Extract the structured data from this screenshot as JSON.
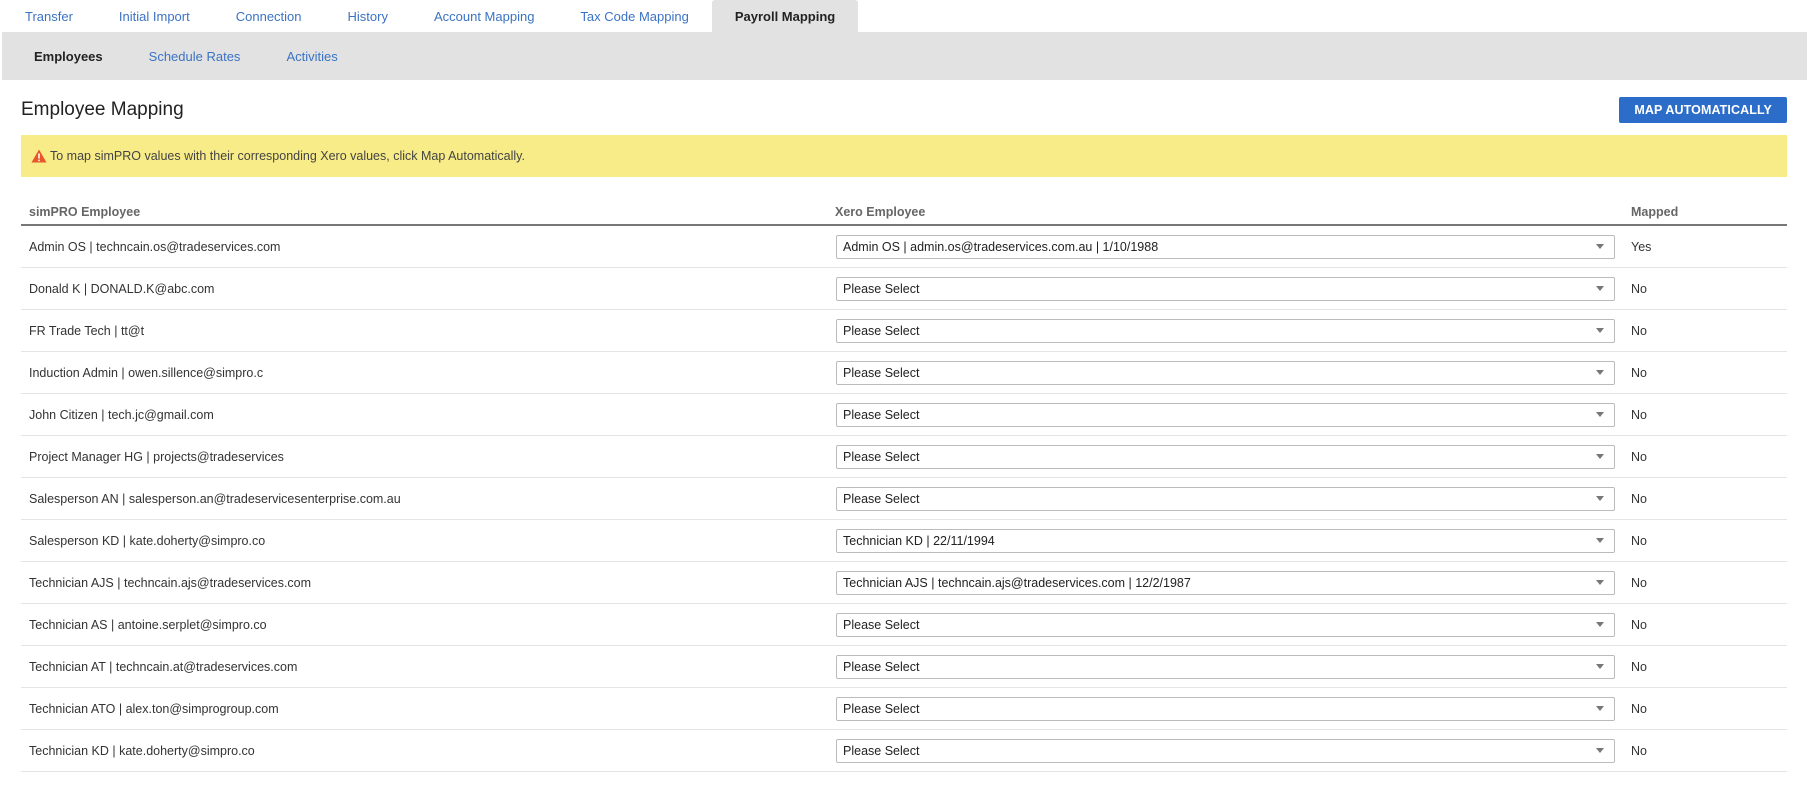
{
  "top_tabs": [
    {
      "label": "Transfer"
    },
    {
      "label": "Initial Import"
    },
    {
      "label": "Connection"
    },
    {
      "label": "History"
    },
    {
      "label": "Account Mapping"
    },
    {
      "label": "Tax Code Mapping"
    },
    {
      "label": "Payroll Mapping"
    }
  ],
  "sub_tabs": [
    {
      "label": "Employees"
    },
    {
      "label": "Schedule Rates"
    },
    {
      "label": "Activities"
    }
  ],
  "header": {
    "title": "Employee Mapping",
    "map_button_label": "MAP AUTOMATICALLY"
  },
  "alert": {
    "icon": "warning-icon",
    "text": "To map simPRO values with their corresponding Xero values, click Map Automatically."
  },
  "table": {
    "columns": [
      "simPRO Employee",
      "Xero Employee",
      "Mapped"
    ],
    "rows": [
      {
        "simpro": "Admin OS | techncain.os@tradeservices.com",
        "xero": "Admin OS | admin.os@tradeservices.com.au | 1/10/1988",
        "mapped": "Yes"
      },
      {
        "simpro": "Donald K | DONALD.K@abc.com",
        "xero": "Please Select",
        "mapped": "No"
      },
      {
        "simpro": "FR Trade Tech | tt@t",
        "xero": "Please Select",
        "mapped": "No"
      },
      {
        "simpro": "Induction Admin | owen.sillence@simpro.c",
        "xero": "Please Select",
        "mapped": "No"
      },
      {
        "simpro": "John Citizen | tech.jc@gmail.com",
        "xero": "Please Select",
        "mapped": "No"
      },
      {
        "simpro": "Project Manager HG | projects@tradeservices",
        "xero": "Please Select",
        "mapped": "No"
      },
      {
        "simpro": "Salesperson AN | salesperson.an@tradeservicesenterprise.com.au",
        "xero": "Please Select",
        "mapped": "No"
      },
      {
        "simpro": "Salesperson KD | kate.doherty@simpro.co",
        "xero": "Technician KD | 22/11/1994",
        "mapped": "No"
      },
      {
        "simpro": "Technician AJS | techncain.ajs@tradeservices.com",
        "xero": "Technician AJS | techncain.ajs@tradeservices.com | 12/2/1987",
        "mapped": "No"
      },
      {
        "simpro": "Technician AS | antoine.serplet@simpro.co",
        "xero": "Please Select",
        "mapped": "No"
      },
      {
        "simpro": "Technician AT | techncain.at@tradeservices.com",
        "xero": "Please Select",
        "mapped": "No"
      },
      {
        "simpro": "Technician ATO | alex.ton@simprogroup.com",
        "xero": "Please Select",
        "mapped": "No"
      },
      {
        "simpro": "Technician KD | kate.doherty@simpro.co",
        "xero": "Please Select",
        "mapped": "No"
      }
    ]
  },
  "colors": {
    "accent": "#2b6dc8",
    "link": "#3b73c4",
    "alert_bg": "#f8ec88",
    "yes": "#3aa63a",
    "no": "#d3262c"
  }
}
